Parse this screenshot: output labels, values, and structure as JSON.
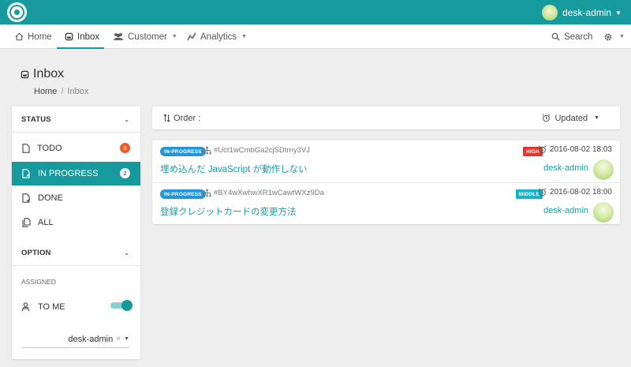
{
  "topbar": {
    "user_name": "desk-admin"
  },
  "nav": {
    "home": "Home",
    "inbox": "Inbox",
    "customer": "Customer",
    "analytics": "Analytics",
    "search": "Search"
  },
  "page": {
    "title": "Inbox",
    "breadcrumb_home": "Home",
    "breadcrumb_sep": "/",
    "breadcrumb_current": "Inbox"
  },
  "sidebar": {
    "status_header": "STATUS",
    "status_items": [
      {
        "label": "TODO",
        "count": "3"
      },
      {
        "label": "IN PROGRESS",
        "count": "2"
      },
      {
        "label": "DONE"
      },
      {
        "label": "ALL"
      }
    ],
    "option_header": "OPTION",
    "assigned_label": "ASSIGNED",
    "to_me_label": "TO ME",
    "to_me_enabled": true,
    "assignee_value": "desk-admin",
    "clear_glyph": "×"
  },
  "order_bar": {
    "order_label": "Order :",
    "sort_label": "Updated"
  },
  "tickets": [
    {
      "status": "IN-PROGRESS",
      "id": "#Uct1wCmbGa2cjSDtrny3VJ",
      "subject": "埋め込んだ JavaScript が動作しない",
      "priority": "HIGH",
      "timestamp": "2016-08-02 18:03",
      "assignee": "desk-admin"
    },
    {
      "status": "IN-PROGRESS",
      "id": "#BY4wXwhwXR1wCawtWXz9Da",
      "subject": "登録クレジットカードの変更方法",
      "priority": "MIDDLE",
      "timestamp": "2016-08-02 18:00",
      "assignee": "desk-admin"
    }
  ],
  "colors": {
    "brand": "#179a9e",
    "status_pill": "#2196d9",
    "priority_high": "#e5362a",
    "priority_middle": "#17b4c9",
    "todo_badge": "#ef5a28"
  },
  "icons": {
    "logo": "desk-logo-icon",
    "home": "home-icon",
    "inbox": "inbox-icon",
    "customer": "users-icon",
    "analytics": "chart-line-icon",
    "search": "search-icon",
    "settings": "gear-icon",
    "order": "sort-icon",
    "updated": "alarm-clock-icon",
    "ticket_tree": "hierarchy-icon",
    "assigned": "person-icon"
  }
}
